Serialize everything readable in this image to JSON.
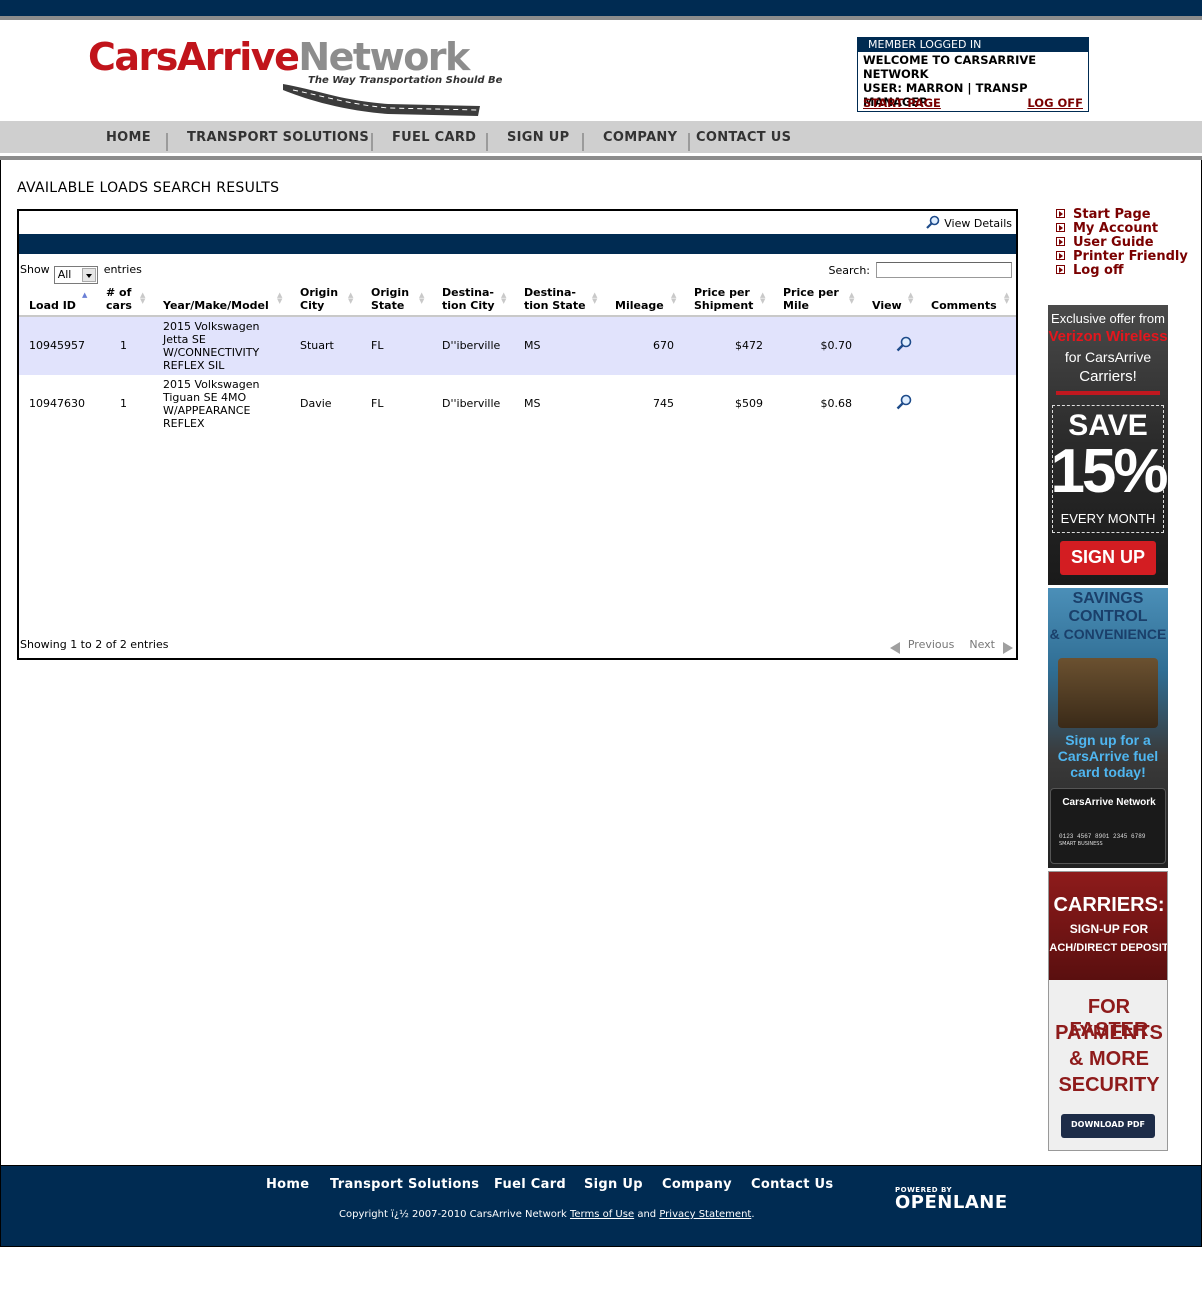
{
  "header": {
    "logo_part1": "CarsArrive",
    "logo_part2": "Network",
    "tagline": "The Way Transportation Should Be",
    "member": {
      "heading": "MEMBER LOGGED IN",
      "welcome": "WELCOME TO CARSARRIVE NETWORK",
      "user": "USER: MARRON | TRANSP MANAGER",
      "start_page": "START PAGE",
      "log_off": "LOG OFF"
    }
  },
  "nav": {
    "items": [
      "HOME",
      "TRANSPORT SOLUTIONS",
      "FUEL CARD",
      "SIGN UP",
      "COMPANY",
      "CONTACT US"
    ]
  },
  "page": {
    "title": "AVAILABLE LOADS SEARCH RESULTS",
    "view_details": "View Details",
    "show_label": "Show",
    "show_value": "All",
    "entries_label": "entries",
    "search_label": "Search:",
    "info": "Showing 1 to 2 of 2 entries",
    "prev": "Previous",
    "next": "Next"
  },
  "table": {
    "headers": [
      [
        "Load ID"
      ],
      [
        "# of",
        "cars"
      ],
      [
        "Year/Make/Model"
      ],
      [
        "Origin",
        "City"
      ],
      [
        "Origin",
        "State"
      ],
      [
        "Destina-",
        "tion City"
      ],
      [
        "Destina-",
        "tion State"
      ],
      [
        "Mileage"
      ],
      [
        "Price per",
        "Shipment"
      ],
      [
        "Price per",
        "Mile"
      ],
      [
        "View"
      ],
      [
        "Comments"
      ]
    ],
    "rows": [
      {
        "load_id": "10945957",
        "cars": "1",
        "model": [
          "2015 Volkswagen",
          "Jetta SE",
          "W/CONNECTIVITY",
          "REFLEX SIL"
        ],
        "origin_city": "Stuart",
        "origin_state": "FL",
        "dest_city": "D''iberville",
        "dest_state": "MS",
        "mileage": "670",
        "price_shipment": "$472",
        "price_mile": "$0.70"
      },
      {
        "load_id": "10947630",
        "cars": "1",
        "model": [
          "2015 Volkswagen",
          "Tiguan SE 4MO",
          "W/APPEARANCE",
          "REFLEX"
        ],
        "origin_city": "Davie",
        "origin_state": "FL",
        "dest_city": "D''iberville",
        "dest_state": "MS",
        "mileage": "745",
        "price_shipment": "$509",
        "price_mile": "$0.68"
      }
    ]
  },
  "sidebar": {
    "links": [
      "Start Page",
      "My Account",
      "User Guide",
      "Printer Friendly",
      "Log off"
    ],
    "ad1": {
      "line1": "Exclusive offer from",
      "line2": "Verizon Wireless",
      "line3": "for CarsArrive",
      "line4": "Carriers!",
      "save": "SAVE",
      "pct": "15%",
      "every": "EVERY MONTH",
      "cta": "SIGN UP"
    },
    "ad2": {
      "line1": "SAVINGS",
      "line2": "CONTROL",
      "line3": "& CONVENIENCE",
      "line4": "Sign up for a",
      "line5": "CarsArrive fuel",
      "line6": "card today!",
      "card_name": "CarsArrive Network",
      "card_number": "0123 4567 8901 2345 6789",
      "card_holder": "SMART BUSINESS"
    },
    "ad3": {
      "line1": "CARRIERS:",
      "line2": "SIGN-UP FOR",
      "line3": "ACH/DIRECT DEPOSIT",
      "line4": "FOR FASTER",
      "line5": "PAYMENTS",
      "line6": "& MORE",
      "line7": "SECURITY",
      "cta": "DOWNLOAD PDF"
    }
  },
  "footer": {
    "links": [
      "Home",
      "Transport Solutions",
      "Fuel Card",
      "Sign Up",
      "Company",
      "Contact Us"
    ],
    "copyright": "Copyright ï¿½ 2007-2010 CarsArrive Network",
    "terms": "Terms of Use",
    "and": "and",
    "privacy": "Privacy Statement",
    "period": ".",
    "powered_by": "POWERED BY",
    "powered_brand": "OPENLANE"
  },
  "colors": {
    "navy": "#002b52",
    "brand_red": "#c1141b",
    "link_maroon": "#7a0000",
    "row_highlight": "#e1e3fc"
  },
  "icons": {
    "view_details": "magnifier-icon",
    "row_view": "magnifier-icon",
    "side_bullet": "arrow-bullet-icon"
  }
}
